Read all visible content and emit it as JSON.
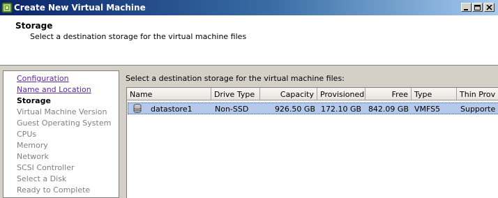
{
  "window": {
    "title": "Create New Virtual Machine",
    "minimize_label": "_",
    "maximize_label": "□",
    "close_label": "×"
  },
  "header": {
    "title": "Storage",
    "subtitle": "Select a destination storage for the virtual machine files"
  },
  "nav": {
    "items": [
      {
        "label": "Configuration",
        "state": "link"
      },
      {
        "label": "Name and Location",
        "state": "link"
      },
      {
        "label": "Storage",
        "state": "current"
      },
      {
        "label": "Virtual Machine Version",
        "state": "disabled"
      },
      {
        "label": "Guest Operating System",
        "state": "disabled"
      },
      {
        "label": "CPUs",
        "state": "disabled"
      },
      {
        "label": "Memory",
        "state": "disabled"
      },
      {
        "label": "Network",
        "state": "disabled"
      },
      {
        "label": "SCSI Controller",
        "state": "disabled"
      },
      {
        "label": "Select a Disk",
        "state": "disabled"
      },
      {
        "label": "Ready to Complete",
        "state": "disabled"
      }
    ]
  },
  "main": {
    "prompt": "Select a destination storage for the virtual machine files:",
    "table": {
      "columns": [
        "Name",
        "Drive Type",
        "Capacity",
        "Provisioned",
        "Free",
        "Type",
        "Thin Prov"
      ],
      "rows": [
        {
          "icon": "datastore-icon",
          "name": "datastore1",
          "drive_type": "Non-SSD",
          "capacity": "926.50 GB",
          "provisioned": "172.10 GB",
          "free": "842.09 GB",
          "type": "VMFS5",
          "thin_prov": "Supporte"
        }
      ]
    }
  },
  "colors": {
    "titlebar_start": "#0a246a",
    "titlebar_end": "#a6caf0",
    "selected_row": "#b5c9ea",
    "link": "#5b2a9c",
    "disabled": "#808080"
  }
}
